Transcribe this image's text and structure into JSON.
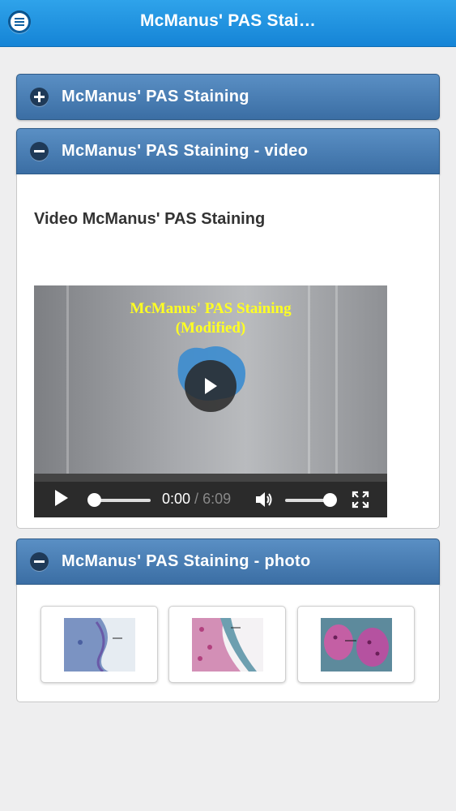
{
  "header": {
    "title": "McManus' PAS Stai…",
    "menu_icon": "menu-icon"
  },
  "sections": [
    {
      "label": "McManus' PAS Staining",
      "state": "collapsed",
      "icon": "plus-icon"
    },
    {
      "label": "McManus' PAS Staining - video",
      "state": "expanded",
      "icon": "minus-icon"
    },
    {
      "label": "McManus' PAS Staining - photo",
      "state": "expanded",
      "icon": "minus-icon"
    }
  ],
  "video_section": {
    "heading": "Video McManus' PAS Staining",
    "overlay_line1": "McManus' PAS Staining",
    "overlay_line2": "(Modified)",
    "current_time": "0:00",
    "separator": " / ",
    "duration": "6:09",
    "progress": 0.0,
    "volume": 1.0
  },
  "photo_section": {
    "thumbnails": [
      {
        "name": "photo-thumbnail-1"
      },
      {
        "name": "photo-thumbnail-2"
      },
      {
        "name": "photo-thumbnail-3"
      }
    ]
  },
  "colors": {
    "header": "#1d8fde",
    "section_header": "#4a7fb5",
    "overlay_text": "#ffff22"
  }
}
